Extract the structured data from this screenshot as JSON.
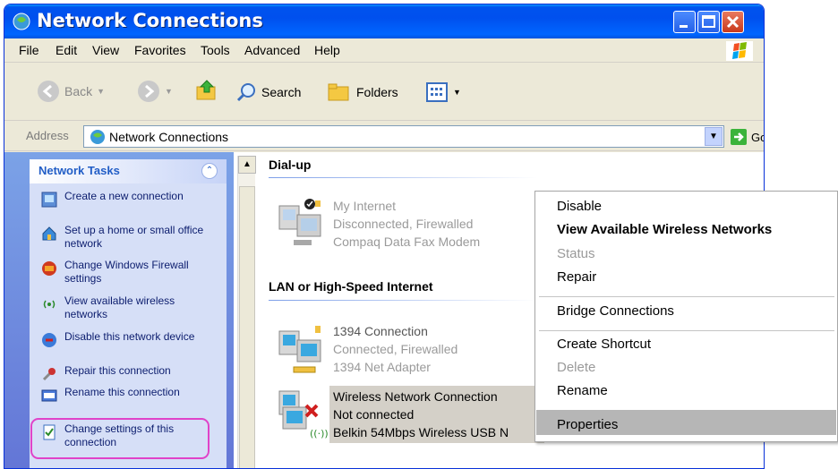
{
  "window": {
    "title": "Network Connections"
  },
  "menu": [
    "File",
    "Edit",
    "View",
    "Favorites",
    "Tools",
    "Advanced",
    "Help"
  ],
  "toolbar": {
    "back": "Back",
    "search": "Search",
    "folders": "Folders"
  },
  "address": {
    "label": "Address",
    "value": "Network Connections",
    "go": "Go"
  },
  "tasks": {
    "title": "Network Tasks",
    "items": [
      "Create a new connection",
      "Set up a home or small office network",
      "Change Windows Firewall settings",
      "View available wireless networks",
      "Disable this network device",
      "Repair this connection",
      "Rename this connection",
      "Change settings of this connection"
    ]
  },
  "groups": {
    "dialup": "Dial-up",
    "lan": "LAN or High-Speed Internet"
  },
  "connections": [
    {
      "name": "My Internet",
      "status": "Disconnected, Firewalled",
      "device": "Compaq Data Fax Modem"
    },
    {
      "name": "1394 Connection",
      "status": "Connected, Firewalled",
      "device": "1394 Net Adapter"
    },
    {
      "name": "Wireless Network Connection",
      "status": "Not connected",
      "device": "Belkin 54Mbps Wireless USB N"
    }
  ],
  "context_menu": {
    "disable": "Disable",
    "view_wireless": "View Available Wireless Networks",
    "status": "Status",
    "repair": "Repair",
    "bridge": "Bridge Connections",
    "shortcut": "Create Shortcut",
    "delete": "Delete",
    "rename": "Rename",
    "properties": "Properties"
  },
  "colors": {
    "titlebar": "#0058ee",
    "taskpane": "#d6dff7",
    "highlight_ring": "#e043c9",
    "selection": "#d4d0c8"
  }
}
